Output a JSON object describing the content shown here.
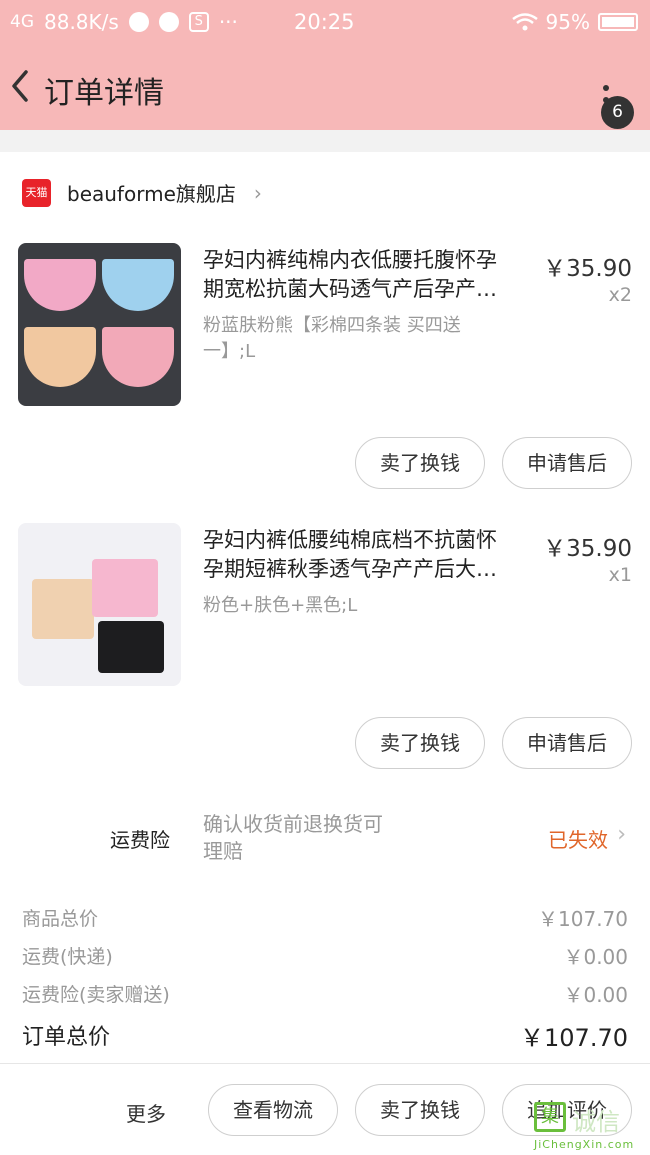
{
  "status_bar": {
    "network": "4G",
    "speed": "88.8K/s",
    "dots": "···",
    "time": "20:25",
    "battery": "95%"
  },
  "nav": {
    "title": "订单详情",
    "badge_count": "6"
  },
  "shop": {
    "badge": "天猫",
    "name": "beauforme旗舰店"
  },
  "products": [
    {
      "title_line1": "孕妇内裤纯棉内衣低腰托腹怀孕",
      "title_line2": "期宽松抗菌大码透气产后孕产…",
      "attrs_line1": "粉蓝肤粉熊【彩棉四条装 买四送",
      "attrs_line2": "一】;L",
      "price": "￥35.90",
      "qty": "x2",
      "buttons": [
        "卖了换钱",
        "申请售后"
      ]
    },
    {
      "title_line1": "孕妇内裤低腰纯棉底档不抗菌怀",
      "title_line2": "孕期短裤秋季透气孕产产后大…",
      "attrs_line1": "粉色+肤色+黑色;L",
      "attrs_line2": "",
      "price": "￥35.90",
      "qty": "x1",
      "buttons": [
        "卖了换钱",
        "申请售后"
      ]
    }
  ],
  "insurance": {
    "label": "运费险",
    "desc_line1": "确认收货前退换货可",
    "desc_line2": "理赔",
    "status": "已失效"
  },
  "summary": {
    "rows": [
      {
        "label": "商品总价",
        "value": "￥107.70"
      },
      {
        "label": "运费(快递)",
        "value": "￥0.00"
      },
      {
        "label": "运费险(卖家赠送)",
        "value": "￥0.00"
      }
    ],
    "total_label": "订单总价",
    "total_value": "￥107.70"
  },
  "bottom_bar": {
    "more": "更多",
    "buttons": [
      "查看物流",
      "卖了换钱",
      "追加评价"
    ]
  },
  "watermark": {
    "glyph": "集",
    "text": "诚信",
    "sub": "JiChengXin.com"
  },
  "colors": {
    "header_bg": "#f7b8b8",
    "status_expired": "#e0662a",
    "tmall_red": "#e8232a"
  }
}
